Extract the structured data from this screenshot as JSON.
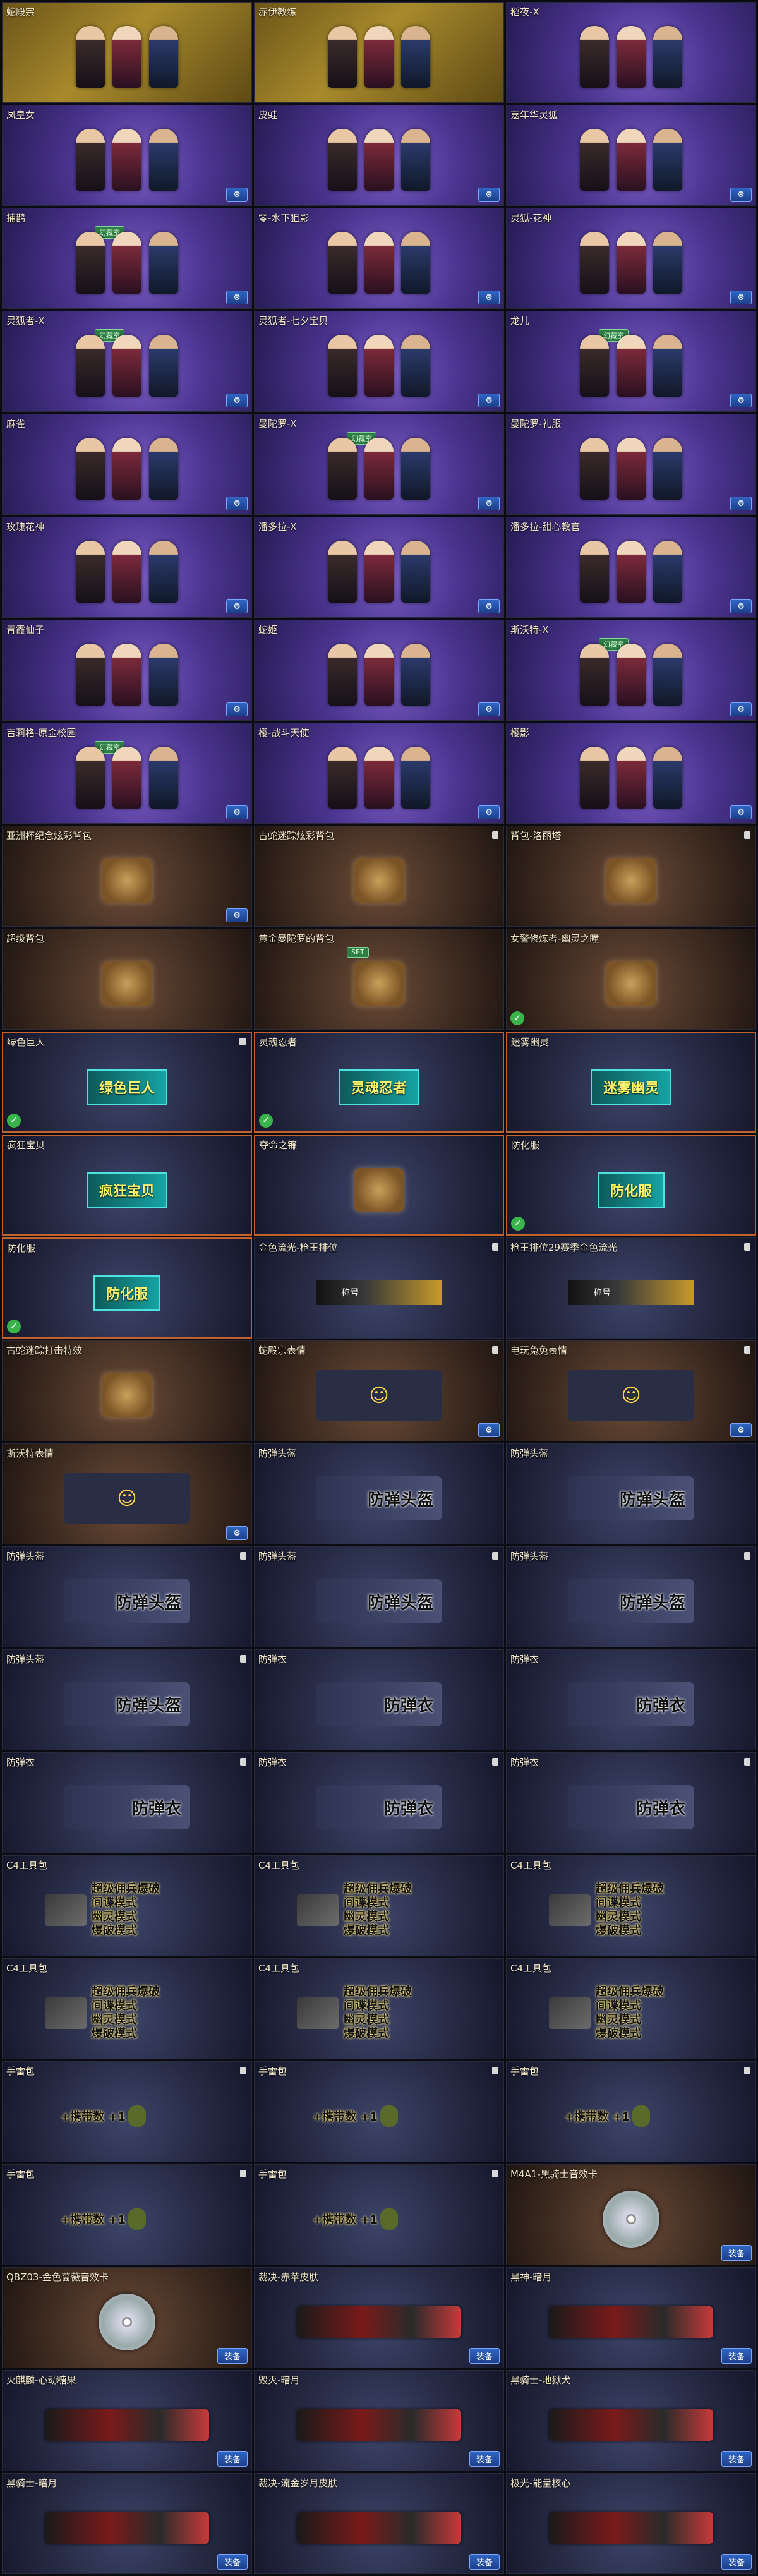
{
  "settings_icon": "gear-icon",
  "ok_icon": "check-icon",
  "items": [
    {
      "title": "蛇殿宗",
      "tag": "",
      "art": "chars",
      "bg": "gold",
      "hl": false,
      "lock": false,
      "ok": false,
      "btn": "",
      "eq": ""
    },
    {
      "title": "赤伊教练",
      "tag": "",
      "art": "chars",
      "bg": "gold",
      "hl": false,
      "lock": false,
      "ok": false,
      "btn": "",
      "eq": ""
    },
    {
      "title": "稻夜-X",
      "tag": "",
      "art": "chars",
      "bg": "purple",
      "hl": false,
      "lock": false,
      "ok": false,
      "btn": "",
      "eq": ""
    },
    {
      "title": "凤皇女",
      "tag": "",
      "art": "chars",
      "bg": "purple",
      "hl": false,
      "lock": false,
      "ok": false,
      "btn": "⚙",
      "eq": ""
    },
    {
      "title": "皮蛙",
      "tag": "",
      "art": "chars",
      "bg": "purple",
      "hl": false,
      "lock": false,
      "ok": false,
      "btn": "⚙",
      "eq": ""
    },
    {
      "title": "嘉年华灵狐",
      "tag": "",
      "art": "chars",
      "bg": "purple",
      "hl": false,
      "lock": false,
      "ok": false,
      "btn": "⚙",
      "eq": ""
    },
    {
      "title": "捕鹊",
      "tag": "幻藏室",
      "art": "chars",
      "bg": "purple",
      "hl": false,
      "lock": false,
      "ok": false,
      "btn": "⚙",
      "eq": ""
    },
    {
      "title": "零-水下狙影",
      "tag": "",
      "art": "chars",
      "bg": "purple",
      "hl": false,
      "lock": false,
      "ok": false,
      "btn": "⚙",
      "eq": ""
    },
    {
      "title": "灵狐-花神",
      "tag": "",
      "art": "chars",
      "bg": "purple",
      "hl": false,
      "lock": false,
      "ok": false,
      "btn": "⚙",
      "eq": ""
    },
    {
      "title": "灵狐者-X",
      "tag": "幻藏室",
      "art": "chars",
      "bg": "purple",
      "hl": false,
      "lock": false,
      "ok": false,
      "btn": "⚙",
      "eq": ""
    },
    {
      "title": "灵狐者-七夕宝贝",
      "tag": "",
      "art": "chars",
      "bg": "purple",
      "hl": false,
      "lock": false,
      "ok": false,
      "btn": "⚙",
      "eq": ""
    },
    {
      "title": "龙儿",
      "tag": "幻藏室",
      "art": "chars",
      "bg": "purple",
      "hl": false,
      "lock": false,
      "ok": false,
      "btn": "⚙",
      "eq": ""
    },
    {
      "title": "麻雀",
      "tag": "",
      "art": "chars",
      "bg": "purple",
      "hl": false,
      "lock": false,
      "ok": false,
      "btn": "⚙",
      "eq": ""
    },
    {
      "title": "曼陀罗-X",
      "tag": "幻藏室",
      "art": "chars",
      "bg": "purple",
      "hl": false,
      "lock": false,
      "ok": false,
      "btn": "⚙",
      "eq": ""
    },
    {
      "title": "曼陀罗-礼服",
      "tag": "",
      "art": "chars",
      "bg": "purple",
      "hl": false,
      "lock": false,
      "ok": false,
      "btn": "⚙",
      "eq": ""
    },
    {
      "title": "玫瑰花神",
      "tag": "",
      "art": "chars",
      "bg": "purple",
      "hl": false,
      "lock": false,
      "ok": false,
      "btn": "⚙",
      "eq": ""
    },
    {
      "title": "潘多拉-X",
      "tag": "",
      "art": "chars",
      "bg": "purple",
      "hl": false,
      "lock": false,
      "ok": false,
      "btn": "⚙",
      "eq": ""
    },
    {
      "title": "潘多拉-甜心教官",
      "tag": "",
      "art": "chars",
      "bg": "purple",
      "hl": false,
      "lock": false,
      "ok": false,
      "btn": "⚙",
      "eq": ""
    },
    {
      "title": "青霞仙子",
      "tag": "",
      "art": "chars",
      "bg": "purple",
      "hl": false,
      "lock": false,
      "ok": false,
      "btn": "⚙",
      "eq": ""
    },
    {
      "title": "蛇姬",
      "tag": "",
      "art": "chars",
      "bg": "purple",
      "hl": false,
      "lock": false,
      "ok": false,
      "btn": "⚙",
      "eq": ""
    },
    {
      "title": "斯沃特-X",
      "tag": "幻藏室",
      "art": "chars",
      "bg": "purple",
      "hl": false,
      "lock": false,
      "ok": false,
      "btn": "⚙",
      "eq": ""
    },
    {
      "title": "吉莉格-原金校园",
      "tag": "幻藏室",
      "art": "chars",
      "bg": "purple",
      "hl": false,
      "lock": false,
      "ok": false,
      "btn": "⚙",
      "eq": ""
    },
    {
      "title": "樱-战斗天使",
      "tag": "",
      "art": "chars",
      "bg": "purple",
      "hl": false,
      "lock": false,
      "ok": false,
      "btn": "⚙",
      "eq": ""
    },
    {
      "title": "樱影",
      "tag": "",
      "art": "chars",
      "bg": "purple",
      "hl": false,
      "lock": false,
      "ok": false,
      "btn": "⚙",
      "eq": ""
    },
    {
      "title": "亚洲杯纪念炫彩背包",
      "tag": "",
      "art": "prop",
      "bg": "brown",
      "hl": false,
      "lock": false,
      "ok": false,
      "btn": "⚙",
      "eq": ""
    },
    {
      "title": "古蛇迷踪炫彩背包",
      "tag": "",
      "art": "prop",
      "bg": "brown",
      "hl": false,
      "lock": true,
      "ok": false,
      "btn": "",
      "eq": ""
    },
    {
      "title": "背包-洛丽塔",
      "tag": "",
      "art": "prop",
      "bg": "brown",
      "hl": false,
      "lock": true,
      "ok": false,
      "btn": "",
      "eq": ""
    },
    {
      "title": "超级背包",
      "tag": "",
      "art": "prop",
      "bg": "brown",
      "hl": false,
      "lock": false,
      "ok": false,
      "btn": "",
      "eq": ""
    },
    {
      "title": "黄金曼陀罗的背包",
      "tag": "SET",
      "art": "prop",
      "bg": "brown",
      "hl": false,
      "lock": false,
      "ok": false,
      "btn": "",
      "eq": ""
    },
    {
      "title": "女警修炼者-幽灵之瞳",
      "tag": "",
      "art": "prop",
      "bg": "brown",
      "hl": false,
      "lock": false,
      "ok": true,
      "btn": "",
      "eq": ""
    },
    {
      "title": "绿色巨人",
      "tag": "",
      "art": "banner",
      "label": "绿色巨人",
      "bg": "navy",
      "hl": true,
      "lock": true,
      "ok": true,
      "btn": "",
      "eq": ""
    },
    {
      "title": "灵魂忍者",
      "tag": "",
      "art": "banner",
      "label": "灵魂忍者",
      "bg": "navy",
      "hl": true,
      "lock": false,
      "ok": true,
      "btn": "",
      "eq": ""
    },
    {
      "title": "迷雾幽灵",
      "tag": "",
      "art": "banner",
      "label": "迷雾幽灵",
      "bg": "navy",
      "hl": true,
      "lock": false,
      "ok": false,
      "btn": "",
      "eq": ""
    },
    {
      "title": "疯狂宝贝",
      "tag": "",
      "art": "banner",
      "label": "疯狂宝贝",
      "bg": "navy",
      "hl": true,
      "lock": false,
      "ok": false,
      "btn": "",
      "eq": ""
    },
    {
      "title": "夺命之镰",
      "tag": "",
      "art": "prop",
      "bg": "navy",
      "hl": true,
      "lock": false,
      "ok": false,
      "btn": "",
      "eq": ""
    },
    {
      "title": "防化服",
      "tag": "",
      "art": "banner",
      "label": "防化服",
      "bg": "navy",
      "hl": true,
      "lock": false,
      "ok": true,
      "btn": "",
      "eq": ""
    },
    {
      "title": "防化服",
      "tag": "",
      "art": "banner",
      "label": "防化服",
      "bg": "navy",
      "hl": true,
      "lock": false,
      "ok": true,
      "btn": "",
      "eq": ""
    },
    {
      "title": "金色流光-枪王排位",
      "tag": "",
      "art": "rank",
      "label": "称号",
      "bg": "navy",
      "hl": false,
      "lock": true,
      "ok": false,
      "btn": "",
      "eq": ""
    },
    {
      "title": "枪王排位29赛季金色流光",
      "tag": "",
      "art": "rank",
      "label": "称号",
      "bg": "navy",
      "hl": false,
      "lock": true,
      "ok": false,
      "btn": "",
      "eq": ""
    },
    {
      "title": "古蛇迷踪打击特效",
      "tag": "",
      "art": "prop",
      "bg": "brown",
      "hl": false,
      "lock": false,
      "ok": false,
      "btn": "",
      "eq": ""
    },
    {
      "title": "蛇殿宗表情",
      "tag": "",
      "art": "emo",
      "bg": "brown",
      "hl": false,
      "lock": true,
      "ok": false,
      "btn": "⚙",
      "eq": ""
    },
    {
      "title": "电玩兔兔表情",
      "tag": "",
      "art": "emo",
      "bg": "brown",
      "hl": false,
      "lock": true,
      "ok": false,
      "btn": "⚙",
      "eq": ""
    },
    {
      "title": "斯沃特表情",
      "tag": "",
      "art": "emo",
      "bg": "brown",
      "hl": false,
      "lock": false,
      "ok": false,
      "btn": "⚙",
      "eq": ""
    },
    {
      "title": "防弹头盔",
      "tag": "",
      "art": "gear",
      "label": "防弹头盔",
      "bg": "navy",
      "hl": false,
      "lock": false,
      "ok": false,
      "btn": "",
      "eq": ""
    },
    {
      "title": "防弹头盔",
      "tag": "",
      "art": "gear",
      "label": "防弹头盔",
      "bg": "navy",
      "hl": false,
      "lock": false,
      "ok": false,
      "btn": "",
      "eq": ""
    },
    {
      "title": "防弹头盔",
      "tag": "",
      "art": "gear",
      "label": "防弹头盔",
      "bg": "navy",
      "hl": false,
      "lock": true,
      "ok": false,
      "btn": "",
      "eq": ""
    },
    {
      "title": "防弹头盔",
      "tag": "",
      "art": "gear",
      "label": "防弹头盔",
      "bg": "navy",
      "hl": false,
      "lock": true,
      "ok": false,
      "btn": "",
      "eq": ""
    },
    {
      "title": "防弹头盔",
      "tag": "",
      "art": "gear",
      "label": "防弹头盔",
      "bg": "navy",
      "hl": false,
      "lock": true,
      "ok": false,
      "btn": "",
      "eq": ""
    },
    {
      "title": "防弹头盔",
      "tag": "",
      "art": "gear",
      "label": "防弹头盔",
      "bg": "navy",
      "hl": false,
      "lock": true,
      "ok": false,
      "btn": "",
      "eq": ""
    },
    {
      "title": "防弹衣",
      "tag": "",
      "art": "gear",
      "label": "防弹衣",
      "bg": "navy",
      "hl": false,
      "lock": false,
      "ok": false,
      "btn": "",
      "eq": ""
    },
    {
      "title": "防弹衣",
      "tag": "",
      "art": "gear",
      "label": "防弹衣",
      "bg": "navy",
      "hl": false,
      "lock": false,
      "ok": false,
      "btn": "",
      "eq": ""
    },
    {
      "title": "防弹衣",
      "tag": "",
      "art": "gear",
      "label": "防弹衣",
      "bg": "navy",
      "hl": false,
      "lock": true,
      "ok": false,
      "btn": "",
      "eq": ""
    },
    {
      "title": "防弹衣",
      "tag": "",
      "art": "gear",
      "label": "防弹衣",
      "bg": "navy",
      "hl": false,
      "lock": true,
      "ok": false,
      "btn": "",
      "eq": ""
    },
    {
      "title": "防弹衣",
      "tag": "",
      "art": "gear",
      "label": "防弹衣",
      "bg": "navy",
      "hl": false,
      "lock": true,
      "ok": false,
      "btn": "",
      "eq": ""
    },
    {
      "title": "C4工具包",
      "tag": "",
      "art": "c4",
      "bg": "navy",
      "hl": false,
      "lock": false,
      "ok": false,
      "btn": "",
      "eq": ""
    },
    {
      "title": "C4工具包",
      "tag": "",
      "art": "c4",
      "bg": "navy",
      "hl": false,
      "lock": false,
      "ok": false,
      "btn": "",
      "eq": ""
    },
    {
      "title": "C4工具包",
      "tag": "",
      "art": "c4",
      "bg": "navy",
      "hl": false,
      "lock": false,
      "ok": false,
      "btn": "",
      "eq": ""
    },
    {
      "title": "C4工具包",
      "tag": "",
      "art": "c4",
      "bg": "navy",
      "hl": false,
      "lock": false,
      "ok": false,
      "btn": "",
      "eq": ""
    },
    {
      "title": "C4工具包",
      "tag": "",
      "art": "c4",
      "bg": "navy",
      "hl": false,
      "lock": false,
      "ok": false,
      "btn": "",
      "eq": ""
    },
    {
      "title": "C4工具包",
      "tag": "",
      "art": "c4",
      "bg": "navy",
      "hl": false,
      "lock": false,
      "ok": false,
      "btn": "",
      "eq": ""
    },
    {
      "title": "手雷包",
      "tag": "",
      "art": "nade",
      "bg": "navy",
      "hl": false,
      "lock": true,
      "ok": false,
      "btn": "",
      "eq": ""
    },
    {
      "title": "手雷包",
      "tag": "",
      "art": "nade",
      "bg": "navy",
      "hl": false,
      "lock": true,
      "ok": false,
      "btn": "",
      "eq": ""
    },
    {
      "title": "手雷包",
      "tag": "",
      "art": "nade",
      "bg": "navy",
      "hl": false,
      "lock": true,
      "ok": false,
      "btn": "",
      "eq": ""
    },
    {
      "title": "手雷包",
      "tag": "",
      "art": "nade",
      "bg": "navy",
      "hl": false,
      "lock": true,
      "ok": false,
      "btn": "",
      "eq": ""
    },
    {
      "title": "手雷包",
      "tag": "",
      "art": "nade",
      "bg": "navy",
      "hl": false,
      "lock": true,
      "ok": false,
      "btn": "",
      "eq": ""
    },
    {
      "title": "M4A1-黑骑士音效卡",
      "tag": "",
      "art": "disc",
      "bg": "brown",
      "hl": false,
      "lock": false,
      "ok": false,
      "btn": "",
      "eq": "装备"
    },
    {
      "title": "QBZ03-金色蔷薇音效卡",
      "tag": "",
      "art": "disc",
      "bg": "brown",
      "hl": false,
      "lock": false,
      "ok": false,
      "btn": "",
      "eq": "装备"
    },
    {
      "title": "裁决-赤苹皮肤",
      "tag": "",
      "art": "gun",
      "bg": "navy",
      "hl": false,
      "lock": false,
      "ok": false,
      "btn": "",
      "eq": "装备"
    },
    {
      "title": "黑神-暗月",
      "tag": "",
      "art": "gun",
      "bg": "navy",
      "hl": false,
      "lock": false,
      "ok": false,
      "btn": "",
      "eq": "装备"
    },
    {
      "title": "火麒麟-心动糖果",
      "tag": "",
      "art": "gun",
      "bg": "navy",
      "hl": false,
      "lock": false,
      "ok": false,
      "btn": "",
      "eq": "装备"
    },
    {
      "title": "毁灭-暗月",
      "tag": "",
      "art": "gun",
      "bg": "navy",
      "hl": false,
      "lock": false,
      "ok": false,
      "btn": "",
      "eq": "装备"
    },
    {
      "title": "黑骑士-地狱犬",
      "tag": "",
      "art": "gun",
      "bg": "navy",
      "hl": false,
      "lock": false,
      "ok": false,
      "btn": "",
      "eq": "装备"
    },
    {
      "title": "黑骑士-暗月",
      "tag": "",
      "art": "gun",
      "bg": "navy",
      "hl": false,
      "lock": false,
      "ok": false,
      "btn": "",
      "eq": "装备"
    },
    {
      "title": "裁决-流金岁月皮肤",
      "tag": "",
      "art": "gun",
      "bg": "navy",
      "hl": false,
      "lock": false,
      "ok": false,
      "btn": "",
      "eq": "装备"
    },
    {
      "title": "极光-能量核心",
      "tag": "",
      "art": "gun",
      "bg": "navy",
      "hl": false,
      "lock": false,
      "ok": false,
      "btn": "",
      "eq": "装备"
    }
  ],
  "c4_lines": [
    "超级佣兵爆破",
    "间谍模式",
    "幽灵模式",
    "爆破模式"
  ],
  "nade_text": "+携带数 +1"
}
